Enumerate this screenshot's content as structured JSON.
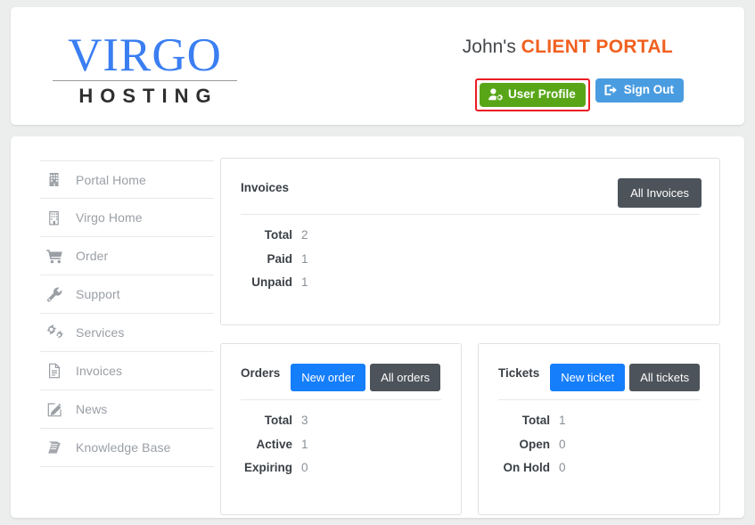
{
  "header": {
    "logo": {
      "primary": "VIRGO",
      "secondary": "HOSTING",
      "primary_color": "#3a7ef2",
      "secondary_color": "#2e2e2e"
    },
    "portal_title_owner": "John's ",
    "portal_title_brand": "CLIENT PORTAL",
    "brand_color": "#f0601f",
    "buttons": {
      "user_profile": {
        "label": "User Profile",
        "icon": "user-gear-icon",
        "color": "#58a618",
        "highlighted": true
      },
      "sign_out": {
        "label": "Sign Out",
        "icon": "sign-out-icon",
        "color": "#4a9ce0"
      }
    },
    "highlight_color": "#ec1c24"
  },
  "sidebar": {
    "items": [
      {
        "label": "Portal Home",
        "icon": "building-icon"
      },
      {
        "label": "Virgo Home",
        "icon": "building-icon"
      },
      {
        "label": "Order",
        "icon": "shopping-cart-icon"
      },
      {
        "label": "Support",
        "icon": "wrench-icon"
      },
      {
        "label": "Services",
        "icon": "gears-icon"
      },
      {
        "label": "Invoices",
        "icon": "file-icon"
      },
      {
        "label": "News",
        "icon": "edit-icon"
      },
      {
        "label": "Knowledge Base",
        "icon": "book-icon"
      }
    ]
  },
  "panels": {
    "invoices": {
      "title": "Invoices",
      "buttons": [
        {
          "label": "All Invoices",
          "style": "dark"
        }
      ],
      "stats": [
        {
          "label": "Total",
          "value": "2"
        },
        {
          "label": "Paid",
          "value": "1"
        },
        {
          "label": "Unpaid",
          "value": "1"
        }
      ]
    },
    "orders": {
      "title": "Orders",
      "buttons": [
        {
          "label": "New order",
          "style": "primary"
        },
        {
          "label": "All orders",
          "style": "dark"
        }
      ],
      "stats": [
        {
          "label": "Total",
          "value": "3"
        },
        {
          "label": "Active",
          "value": "1"
        },
        {
          "label": "Expiring",
          "value": "0"
        }
      ]
    },
    "tickets": {
      "title": "Tickets",
      "buttons": [
        {
          "label": "New ticket",
          "style": "primary"
        },
        {
          "label": "All tickets",
          "style": "dark"
        }
      ],
      "stats": [
        {
          "label": "Total",
          "value": "1"
        },
        {
          "label": "Open",
          "value": "0"
        },
        {
          "label": "On Hold",
          "value": "0"
        }
      ]
    }
  }
}
